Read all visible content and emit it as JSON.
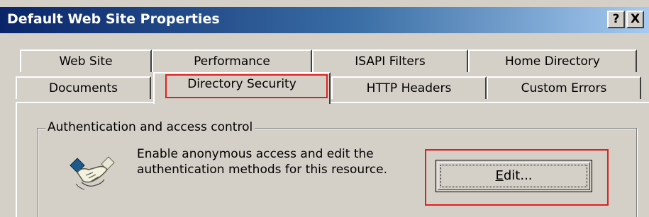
{
  "window": {
    "title": "Default Web Site Properties",
    "help_button": "?",
    "close_button": "X"
  },
  "tabs_back_row": [
    "Web Site",
    "Performance",
    "ISAPI Filters",
    "Home Directory"
  ],
  "tabs_front_row": [
    "Documents",
    "Directory Security",
    "HTTP Headers",
    "Custom Errors"
  ],
  "selected_tab": "Directory Security",
  "auth_section": {
    "group_label": "Authentication and access control",
    "description_line1": "Enable anonymous access and edit the",
    "description_line2": "authentication methods for this resource.",
    "edit_button": "Edit...",
    "icon": "handshake-icon"
  },
  "colors": {
    "titlebar_start": "#0a246a",
    "titlebar_end": "#a6caf0",
    "highlight": "#e02020",
    "face": "#d4d0c8"
  }
}
